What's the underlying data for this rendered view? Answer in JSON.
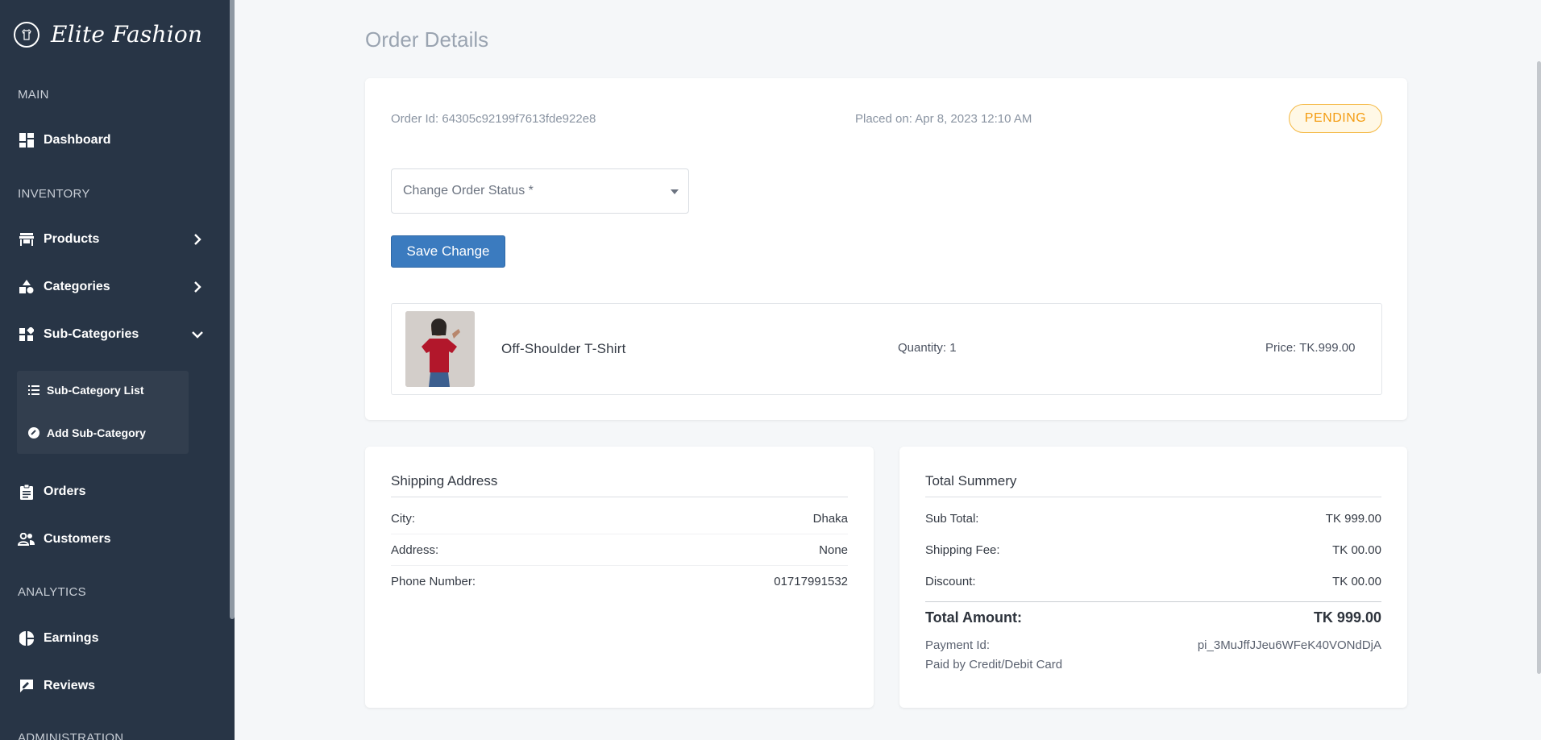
{
  "brand": {
    "name": "Elite Fashion"
  },
  "sidebar": {
    "sections": {
      "main": "MAIN",
      "inventory": "INVENTORY",
      "analytics": "ANALYTICS",
      "administration": "ADMINISTRATION"
    },
    "items": {
      "dashboard": "Dashboard",
      "products": "Products",
      "categories": "Categories",
      "subcategories": "Sub-Categories",
      "subcategory_list": "Sub-Category List",
      "add_subcategory": "Add Sub-Category",
      "orders": "Orders",
      "customers": "Customers",
      "earnings": "Earnings",
      "reviews": "Reviews"
    }
  },
  "page": {
    "title": "Order Details"
  },
  "order": {
    "id_text": "Order Id: 64305c92199f7613fde922e8",
    "placed_text": "Placed on: Apr 8, 2023 12:10 AM",
    "status": "PENDING",
    "status_select_placeholder": "Change Order Status *",
    "save_label": "Save Change"
  },
  "product": {
    "name": "Off-Shoulder T-Shirt",
    "quantity_text": "Quantity: 1",
    "price_text": "Price: TK.999.00"
  },
  "shipping": {
    "title": "Shipping Address",
    "rows": [
      {
        "label": "City:",
        "value": "Dhaka"
      },
      {
        "label": "Address:",
        "value": "None"
      },
      {
        "label": "Phone Number:",
        "value": "01717991532"
      }
    ]
  },
  "summary": {
    "title": "Total Summery",
    "rows": [
      {
        "label": "Sub Total:",
        "value": "TK 999.00"
      },
      {
        "label": "Shipping Fee:",
        "value": "TK 00.00"
      },
      {
        "label": "Discount:",
        "value": "TK 00.00"
      }
    ],
    "total_label": "Total Amount:",
    "total_value": "TK 999.00",
    "payment_label": "Payment Id:",
    "payment_value": "pi_3MuJffJJeu6WFeK40VONdDjA",
    "paid_by": "Paid by Credit/Debit Card"
  },
  "colors": {
    "sidebar_bg": "#283546",
    "accent_button": "#3b7bbf",
    "status_pending": "#f39c12"
  }
}
